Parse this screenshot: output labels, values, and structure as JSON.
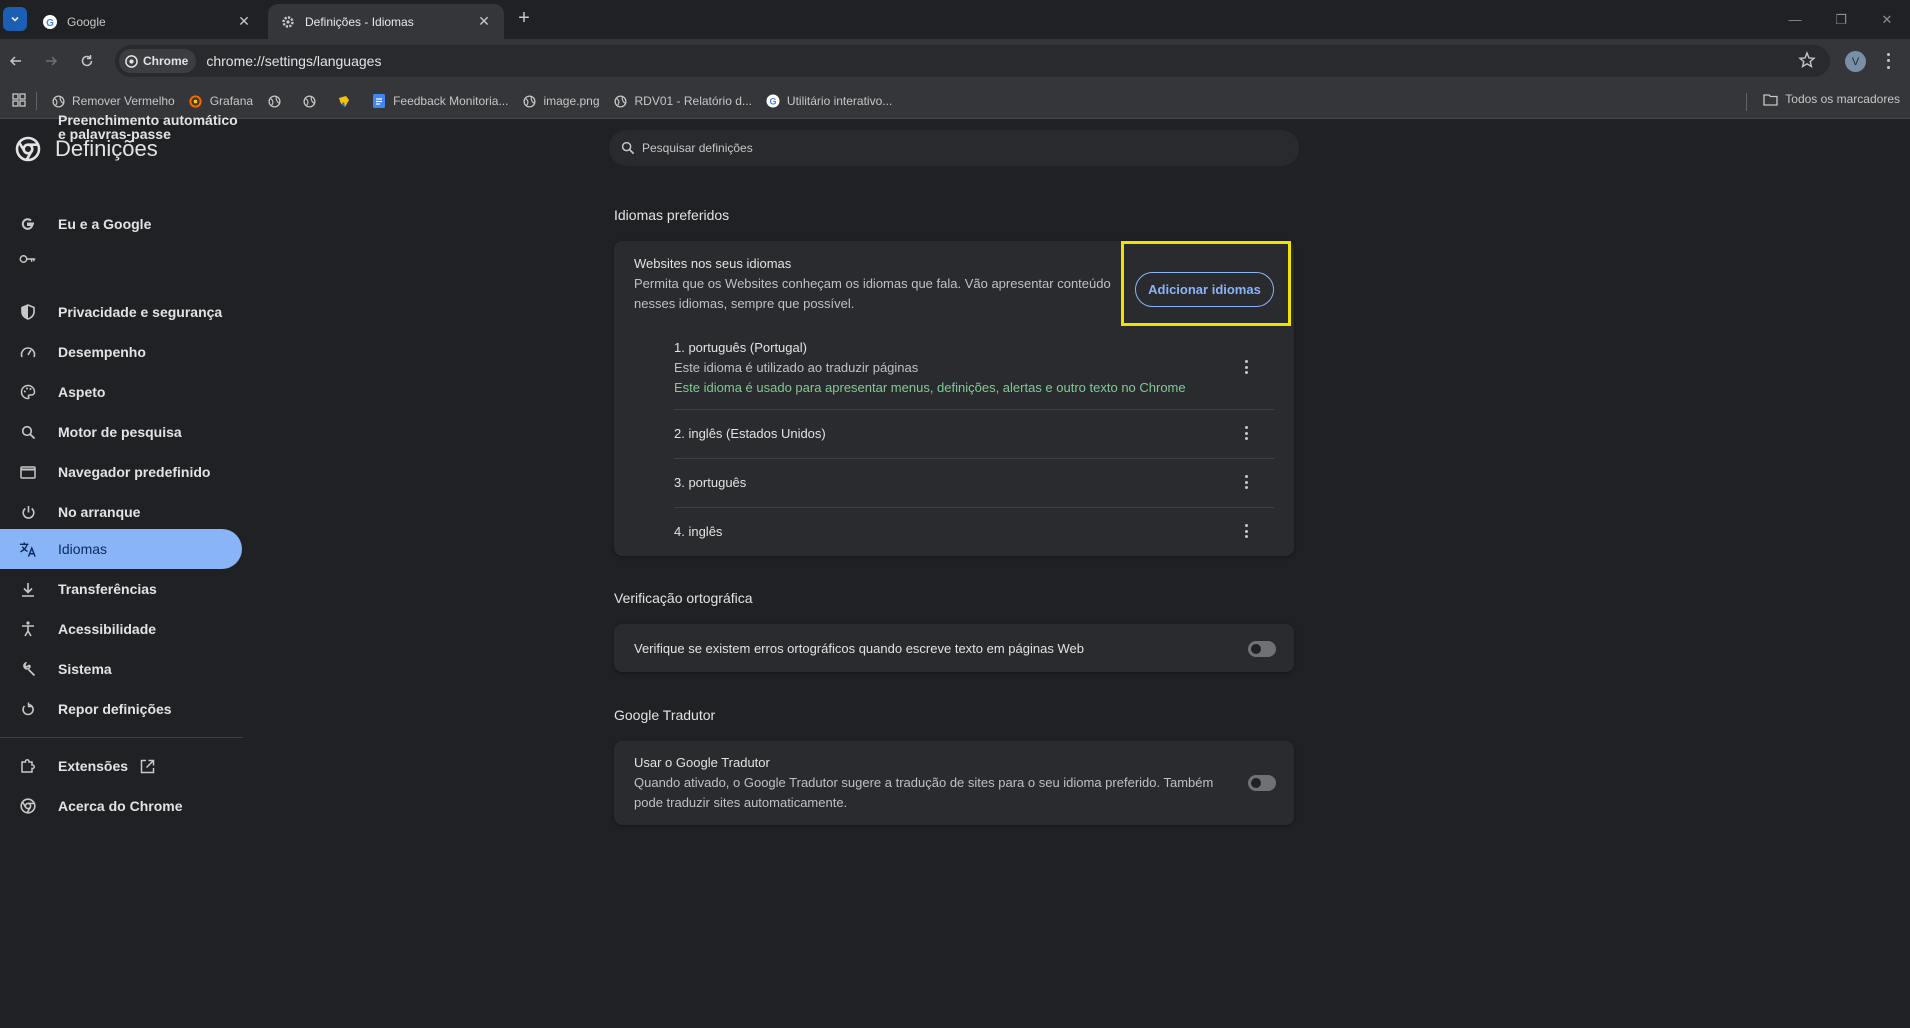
{
  "browser": {
    "tabs": [
      {
        "title": "Google",
        "active": false
      },
      {
        "title": "Definições - Idiomas",
        "active": true
      }
    ],
    "omnibox": {
      "chip_label": "Chrome",
      "url": "chrome://settings/languages"
    },
    "profile_initial": "V"
  },
  "bookmarks": {
    "items": [
      {
        "label": "Remover Vermelho",
        "icon": "globe-icon"
      },
      {
        "label": "Grafana",
        "icon": "grafana-icon"
      },
      {
        "label": "",
        "icon": "globe-icon"
      },
      {
        "label": "",
        "icon": "globe-icon"
      },
      {
        "label": "",
        "icon": "hand-icon"
      },
      {
        "label": "Feedback Monitoria...",
        "icon": "docs-icon"
      },
      {
        "label": "image.png",
        "icon": "globe-icon"
      },
      {
        "label": "RDV01 - Relatório d...",
        "icon": "globe-icon"
      },
      {
        "label": "Utilitário interativo...",
        "icon": "google-icon"
      }
    ],
    "all_bookmarks": "Todos os marcadores"
  },
  "sidebar": {
    "title": "Definições",
    "items": [
      {
        "label": "Eu e a Google",
        "icon": "google-g-icon"
      },
      {
        "label": "Preenchimento automático e palavras-passe",
        "icon": "key-icon"
      },
      {
        "label": "Privacidade e segurança",
        "icon": "shield-icon"
      },
      {
        "label": "Desempenho",
        "icon": "speedometer-icon"
      },
      {
        "label": "Aspeto",
        "icon": "palette-icon"
      },
      {
        "label": "Motor de pesquisa",
        "icon": "search-icon"
      },
      {
        "label": "Navegador predefinido",
        "icon": "browser-window-icon"
      },
      {
        "label": "No arranque",
        "icon": "power-icon"
      },
      {
        "label": "Idiomas",
        "icon": "translate-icon",
        "selected": true
      },
      {
        "label": "Transferências",
        "icon": "download-icon"
      },
      {
        "label": "Acessibilidade",
        "icon": "accessibility-icon"
      },
      {
        "label": "Sistema",
        "icon": "wrench-icon"
      },
      {
        "label": "Repor definições",
        "icon": "reset-icon"
      },
      {
        "label": "Extensões",
        "icon": "puzzle-icon"
      },
      {
        "label": "Acerca do Chrome",
        "icon": "chrome-icon"
      }
    ]
  },
  "search": {
    "placeholder": "Pesquisar definições"
  },
  "preferred_languages": {
    "section_title": "Idiomas preferidos",
    "websites_title": "Websites nos seus idiomas",
    "websites_desc_line1": "Permita que os Websites conheçam os idiomas que fala. Vão apresentar conteúdo",
    "websites_desc_line2": "nesses idiomas, sempre que possível.",
    "add_button": "Adicionar idiomas",
    "languages": [
      {
        "name": "1. português (Portugal)",
        "sub": "Este idioma é utilizado ao traduzir páginas",
        "ui_note": "Este idioma é usado para apresentar menus, definições, alertas e outro texto no Chrome"
      },
      {
        "name": "2. inglês (Estados Unidos)"
      },
      {
        "name": "3. português"
      },
      {
        "name": "4. inglês"
      }
    ]
  },
  "spellcheck": {
    "section_title": "Verificação ortográfica",
    "label": "Verifique se existem erros ortográficos quando escreve texto em páginas Web",
    "enabled": false
  },
  "translate": {
    "section_title": "Google Tradutor",
    "title": "Usar o Google Tradutor",
    "desc_line1": "Quando ativado, o Google Tradutor sugere a tradução de sites para o seu idioma preferido. Também",
    "desc_line2": "pode traduzir sites automaticamente.",
    "enabled": false
  },
  "colors": {
    "accent": "#8ab4f8",
    "highlight": "#f3e200",
    "ui_language_note": "#81c995"
  }
}
